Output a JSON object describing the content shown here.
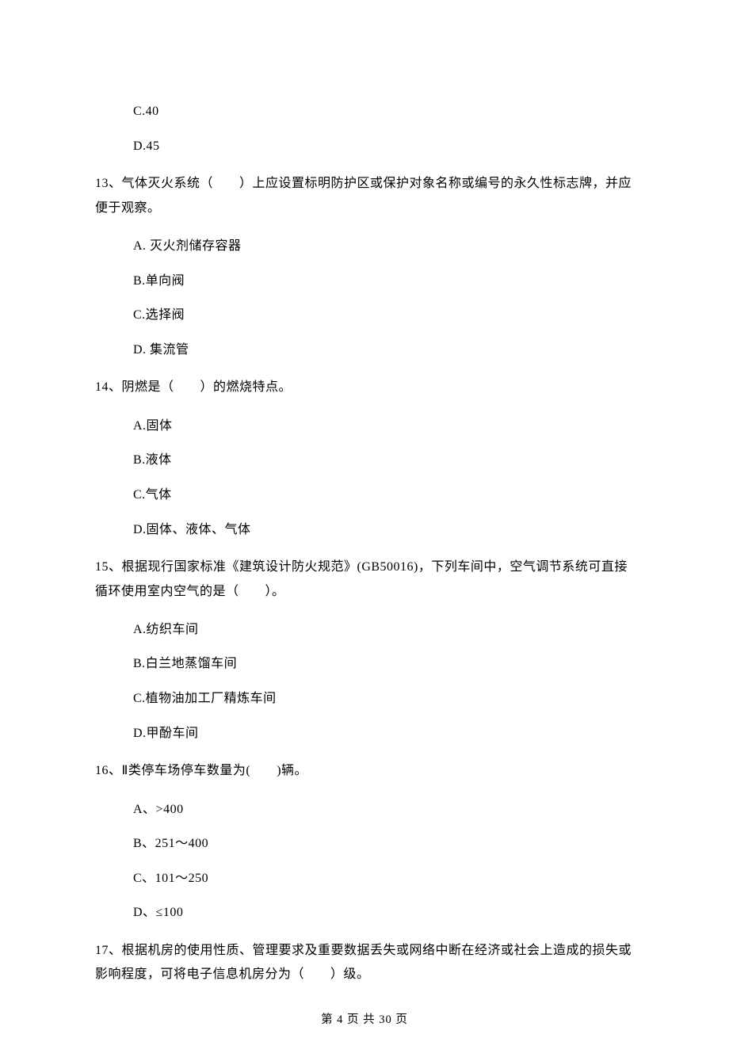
{
  "leading_options": {
    "c": "C.40",
    "d": "D.45"
  },
  "q13": {
    "text": "13、气体灭火系统（　　）上应设置标明防护区或保护对象名称或编号的永久性标志牌，并应便于观察。",
    "a": "A. 灭火剂储存容器",
    "b": "B.单向阀",
    "c": "C.选择阀",
    "d": "D. 集流管"
  },
  "q14": {
    "text": "14、阴燃是（　　）的燃烧特点。",
    "a": "A.固体",
    "b": "B.液体",
    "c": "C.气体",
    "d": "D.固体、液体、气体"
  },
  "q15": {
    "text": "15、根据现行国家标准《建筑设计防火规范》(GB50016)，下列车间中，空气调节系统可直接循环使用室内空气的是（　　）。",
    "a": "A.纺织车间",
    "b": "B.白兰地蒸馏车间",
    "c": "C.植物油加工厂精炼车间",
    "d": "D.甲酚车间"
  },
  "q16": {
    "text": "16、Ⅱ类停车场停车数量为(　　)辆。",
    "a": "A、>400",
    "b": "B、251～400",
    "c": "C、101～250",
    "d": "D、≤100"
  },
  "q17": {
    "text": "17、根据机房的使用性质、管理要求及重要数据丢失或网络中断在经济或社会上造成的损失或影响程度，可将电子信息机房分为（　　）级。"
  },
  "footer": "第 4 页 共 30 页"
}
